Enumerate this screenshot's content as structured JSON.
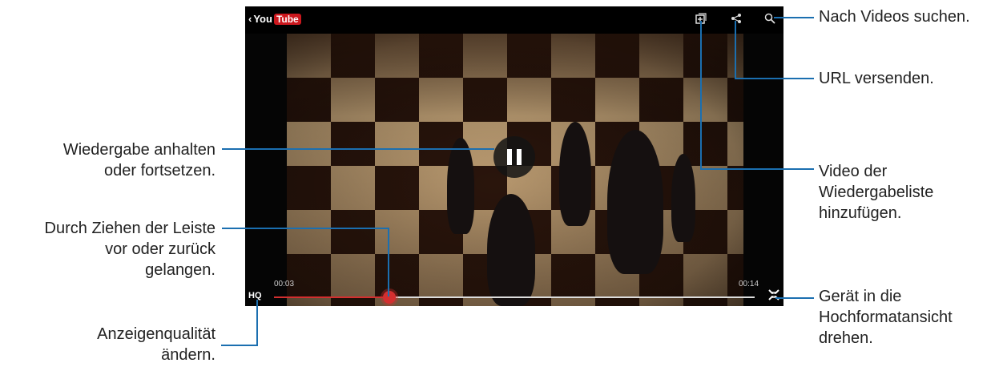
{
  "player": {
    "back_glyph": "‹",
    "brand_you": "You",
    "brand_tube": "Tube",
    "icons": {
      "add_to_playlist": "add-to-playlist-icon",
      "share": "share-icon",
      "search": "search-icon",
      "pause": "pause-icon",
      "rotate": "rotate-icon"
    },
    "elapsed": "00:03",
    "duration": "00:14",
    "progress_fraction": 0.24,
    "quality_label": "HQ"
  },
  "callouts": {
    "search": "Nach Videos suchen.",
    "share": "URL versenden.",
    "playlist": [
      "Video der",
      "Wiedergabeliste",
      "hinzufügen."
    ],
    "rotate": [
      "Gerät in die",
      "Hochformatansicht",
      "drehen."
    ],
    "pause": [
      "Wiedergabe anhalten",
      "oder fortsetzen."
    ],
    "seek": [
      "Durch Ziehen der Leiste",
      "vor oder zurück",
      "gelangen."
    ],
    "quality": [
      "Anzeigenqualität",
      "ändern."
    ]
  },
  "colors": {
    "accent": "#cc181e",
    "progress": "#d32f2f",
    "callout_line": "#1b6fb0"
  }
}
